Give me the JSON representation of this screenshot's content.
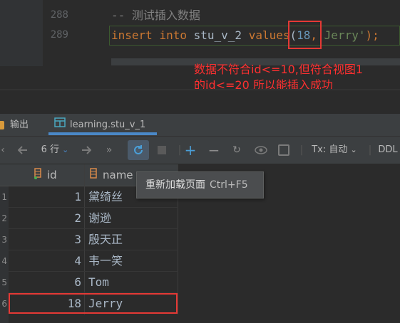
{
  "editor": {
    "lines": [
      {
        "number": "288",
        "comment": "-- 测试插入数据"
      },
      {
        "number": "289",
        "kw_insert": "insert",
        "kw_into": "into",
        "table": "stu_v_2",
        "kw_values": "values",
        "open": "(",
        "num": "18",
        "comma": ",",
        "str": "'Jerry'",
        "close": ");"
      }
    ]
  },
  "annotation": {
    "line1": "数据不符合id<=10,但符合视图1",
    "line2": "的id<=20 所以能插入成功"
  },
  "tabs": {
    "output": "输出",
    "table": "learning.stu_v_1",
    "close": "×"
  },
  "toolbar": {
    "rows": "6 行",
    "tx": "Tx: 自动",
    "ddl": "DDL"
  },
  "grid": {
    "columns": [
      "id",
      "name"
    ],
    "rows": [
      {
        "n": "1",
        "id": "1",
        "name": "黛绮丝"
      },
      {
        "n": "2",
        "id": "2",
        "name": "谢逊"
      },
      {
        "n": "3",
        "id": "3",
        "name": "殷天正"
      },
      {
        "n": "4",
        "id": "4",
        "name": "韦一笑"
      },
      {
        "n": "5",
        "id": "6",
        "name": "Tom"
      },
      {
        "n": "6",
        "id": "18",
        "name": "Jerry"
      }
    ]
  },
  "tooltip": {
    "label": "重新加载页面",
    "shortcut": "Ctrl+F5"
  },
  "colors": {
    "keyword": "#cc7832",
    "number": "#6897bb",
    "string": "#6a8759",
    "highlight_box": "#e53935",
    "annotation": "#ff3030"
  }
}
